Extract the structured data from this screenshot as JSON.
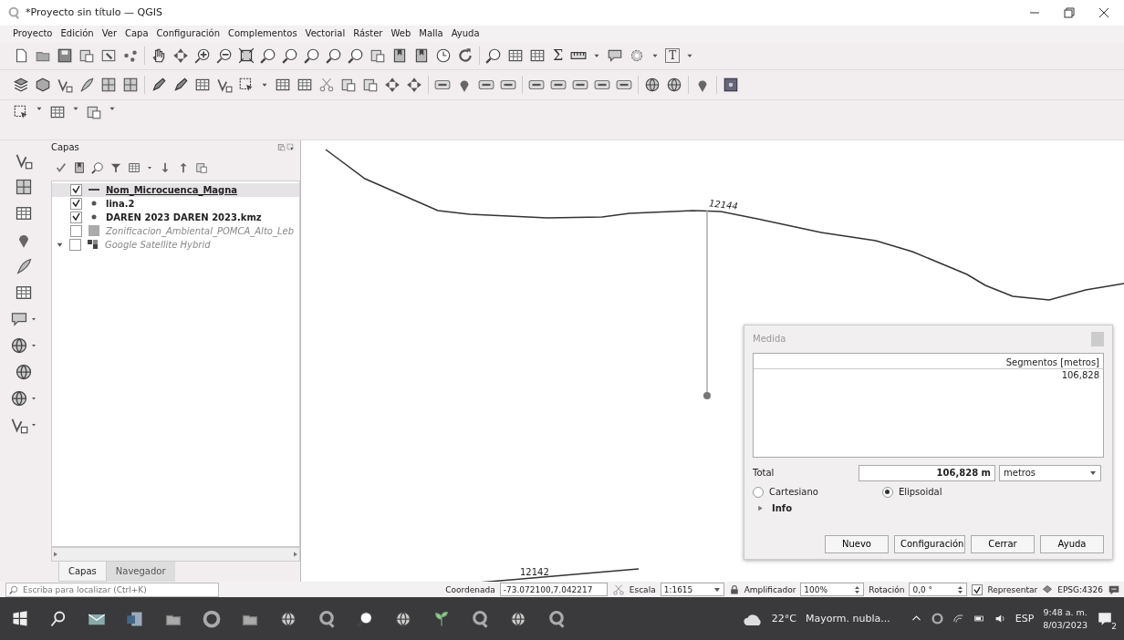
{
  "window": {
    "title": "*Proyecto sin título — QGIS"
  },
  "menu": [
    "Proyecto",
    "Edición",
    "Ver",
    "Capa",
    "Configuración",
    "Complementos",
    "Vectorial",
    "Ráster",
    "Web",
    "Malla",
    "Ayuda"
  ],
  "toolbar": {
    "sigma_button": "Σ",
    "text_button": "T"
  },
  "layers": {
    "title": "Capas",
    "items": [
      {
        "name": "Nom_Microcuenca_Magna",
        "kind": "line",
        "checked": true,
        "selected": true,
        "expanded": false
      },
      {
        "name": "lina.2",
        "kind": "point",
        "checked": true,
        "selected": false,
        "expanded": false
      },
      {
        "name": "DAREN 2023 DAREN 2023.kmz",
        "kind": "point",
        "checked": true,
        "selected": false,
        "expanded": false
      },
      {
        "name": "Zonificacion_Ambiental_POMCA_Alto_Leb",
        "kind": "polygon",
        "checked": false,
        "selected": false,
        "expanded": false
      },
      {
        "name": "Google Satellite Hybrid",
        "kind": "raster",
        "checked": false,
        "selected": false,
        "expanded": true
      }
    ],
    "tabs": [
      {
        "label": "Capas",
        "selected": true
      },
      {
        "label": "Navegador",
        "selected": false
      }
    ]
  },
  "map": {
    "labels": [
      {
        "text": "12144"
      },
      {
        "text": "12142"
      }
    ]
  },
  "measure": {
    "title": "Medida",
    "column": "Segmentos [metros]",
    "segments": [
      "106,828"
    ],
    "total_label": "Total",
    "total": "106,828 m",
    "unit": "metros",
    "modes": [
      {
        "label": "Cartesiano",
        "selected": false
      },
      {
        "label": "Elipsoidal",
        "selected": true
      }
    ],
    "info": {
      "label": "Info",
      "expanded": false
    },
    "buttons": [
      "Nuevo",
      "Configuración",
      "Cerrar",
      "Ayuda"
    ]
  },
  "status_bar": {
    "search_placeholder": "Escriba para localizar (Ctrl+K)",
    "coordinate_label": "Coordenada",
    "coordinate": "-73.072100,7.042217",
    "scale_label": "Escala",
    "scale": "1:1615",
    "magnifier_label": "Amplificador",
    "magnifier": "100%",
    "rotation_label": "Rotación",
    "rotation": "0,0 °",
    "render": {
      "label": "Representar",
      "checked": true
    },
    "crs": "EPSG:4326"
  },
  "taskbar": {
    "temperature": "22°C",
    "weather": "Mayorm. nubla...",
    "language": "ESP",
    "time": "9:48 a. m.",
    "date": "8/03/2023",
    "notifications": "2"
  }
}
